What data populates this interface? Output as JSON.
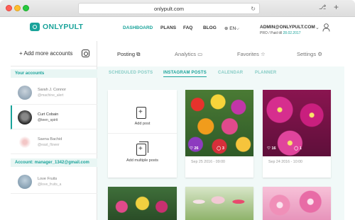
{
  "browser": {
    "url": "onlypult.com",
    "reload_icon": "reload-icon"
  },
  "header": {
    "brand": "ONLYPULT",
    "nav": [
      "DASHBOARD",
      "PLANS",
      "FAQ",
      "BLOG",
      "⊕ EN⌵"
    ],
    "account_email": "ADMIN@ONLYPULT.COM",
    "account_plan_prefix": "PRO / Paid till ",
    "account_plan_date": "28.02.2017",
    "accent_color": "#1aa39a"
  },
  "sidebar": {
    "add_label": "+ Add more accounts",
    "your_accounts_label": "Your accounts",
    "accounts": [
      {
        "name": "Sarah J. Connor",
        "handle": "@machine_alert"
      },
      {
        "name": "Curt Cobain",
        "handle": "@teen_spirit"
      },
      {
        "name": "Saena Bachid",
        "handle": "@east_flower"
      }
    ],
    "manager_label": "Account: manager_1342@gmail.com",
    "manager_accounts": [
      {
        "name": "Love Fruits",
        "handle": "@love_fruits_a"
      }
    ]
  },
  "tabs": [
    "Posting",
    "Analytics",
    "Favorites",
    "Settings"
  ],
  "subtabs": [
    "SCHEDULED POSTS",
    "INSTAGRAM POSTS",
    "CALENDAR",
    "PLANNER"
  ],
  "new_post": {
    "add_post": "Add post",
    "add_multiple": "Add multiple posts"
  },
  "posts": [
    {
      "likes": "26",
      "comments": "3",
      "date": "Sep 25 2016 - 09:00"
    },
    {
      "likes": "16",
      "comments": "1",
      "date": "Sep 24 2016 - 10:00"
    }
  ]
}
